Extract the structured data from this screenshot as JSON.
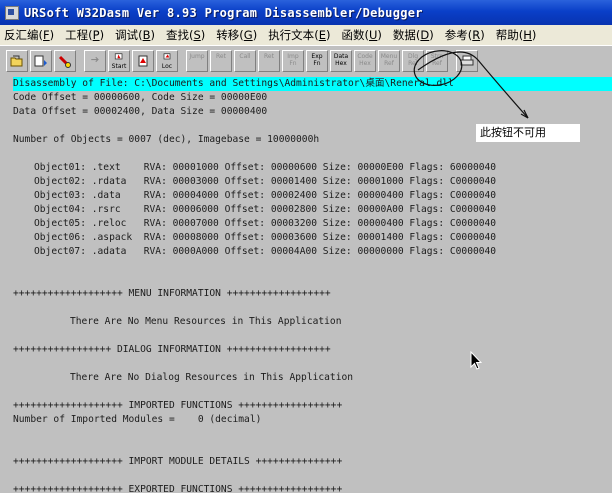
{
  "window": {
    "title": "URSoft W32Dasm Ver 8.93 Program Disassembler/Debugger"
  },
  "menu": [
    {
      "label": "反汇编",
      "accel": "F"
    },
    {
      "label": "工程",
      "accel": "P"
    },
    {
      "label": "调试",
      "accel": "B"
    },
    {
      "label": "查找",
      "accel": "S"
    },
    {
      "label": "转移",
      "accel": "G"
    },
    {
      "label": "执行文本",
      "accel": "E"
    },
    {
      "label": "函数",
      "accel": "U"
    },
    {
      "label": "数据",
      "accel": "D"
    },
    {
      "label": "参考",
      "accel": "R"
    },
    {
      "label": "帮助",
      "accel": "H"
    }
  ],
  "toolbar": {
    "buttons": [
      {
        "name": "open-disasm-button",
        "label": "",
        "icon": "open-file-icon",
        "enabled": true
      },
      {
        "name": "save-disasm-button",
        "label": "",
        "icon": "save-file-icon",
        "enabled": true
      },
      {
        "name": "find-button",
        "label": "",
        "icon": "flashlight-icon",
        "enabled": true
      },
      {
        "name": "goto-code-start-button",
        "label": "",
        "icon": "goto-icon",
        "enabled": false
      },
      {
        "name": "program-entry-button",
        "label": "Start",
        "icon": "entry-point-icon",
        "enabled": true
      },
      {
        "name": "goto-page-button",
        "label": "",
        "icon": "page-icon",
        "enabled": true
      },
      {
        "name": "goto-code-location-button",
        "label": "Loc",
        "icon": "location-icon",
        "enabled": true
      },
      {
        "name": "execute-jump-button",
        "label": "Jump",
        "icon": "jump-icon",
        "enabled": false
      },
      {
        "name": "return-from-jump-button",
        "label": "Ret",
        "icon": "return-icon",
        "enabled": false
      },
      {
        "name": "execute-call-button",
        "label": "Call",
        "icon": "call-icon",
        "enabled": false
      },
      {
        "name": "return-from-call-button",
        "label": "Ret",
        "icon": "return-icon",
        "enabled": false
      },
      {
        "name": "imports-button",
        "label": "Imp Fn",
        "icon": "imports-icon",
        "enabled": false
      },
      {
        "name": "exports-button",
        "label": "Exp Fn",
        "icon": "exports-icon",
        "enabled": true
      },
      {
        "name": "hex-data-button",
        "label": "Data Hex",
        "icon": "hex-data-icon",
        "enabled": true
      },
      {
        "name": "hex-code-button",
        "label": "Code Hex",
        "icon": "hex-code-icon",
        "enabled": false
      },
      {
        "name": "menu-ref-button",
        "label": "Menu Ref",
        "icon": "menu-ref-icon",
        "enabled": false
      },
      {
        "name": "dialog-ref-button",
        "label": "Dlg Ref",
        "icon": "dialog-ref-icon",
        "enabled": false
      },
      {
        "name": "string-ref-button",
        "label": "Strn Ref",
        "icon": "string-ref-icon",
        "enabled": false
      },
      {
        "name": "print-button",
        "label": "",
        "icon": "printer-icon",
        "enabled": true
      }
    ]
  },
  "listing": {
    "header": "Disassembly of File: C:\\Documents and Settings\\Administrator\\桌面\\Reneral.dll",
    "code_line": "Code Offset = 00000600, Code Size = 00000E00",
    "data_line": "Data Offset = 00002400, Data Size = 00000400",
    "objects_line": "Number of Objects = 0007 (dec), Imagebase = 10000000h",
    "objects": [
      "Object01: .text    RVA: 00001000 Offset: 00000600 Size: 00000E00 Flags: 60000040",
      "Object02: .rdata   RVA: 00003000 Offset: 00001400 Size: 00001000 Flags: C0000040",
      "Object03: .data    RVA: 00004000 Offset: 00002400 Size: 00000400 Flags: C0000040",
      "Object04: .rsrc    RVA: 00006000 Offset: 00002800 Size: 00000A00 Flags: C0000040",
      "Object05: .reloc   RVA: 00007000 Offset: 00003200 Size: 00000400 Flags: C0000040",
      "Object06: .aspack  RVA: 00008000 Offset: 00003600 Size: 00001400 Flags: C0000040",
      "Object07: .adata   RVA: 0000A000 Offset: 00004A00 Size: 00000000 Flags: C0000040"
    ],
    "menu_section": "+++++++++++++++++++ MENU INFORMATION ++++++++++++++++++",
    "menu_none": "There Are No Menu Resources in This Application",
    "dialog_section": "+++++++++++++++++ DIALOG INFORMATION ++++++++++++++++++",
    "dialog_none": "There Are No Dialog Resources in This Application",
    "imported_section": "+++++++++++++++++++ IMPORTED FUNCTIONS ++++++++++++++++++",
    "imported_count": "Number of Imported Modules =    0 (decimal)",
    "import_details_section": "+++++++++++++++++++ IMPORT MODULE DETAILS +++++++++++++++",
    "exported_section": "+++++++++++++++++++ EXPORTED FUNCTIONS ++++++++++++++++++"
  },
  "annotation": {
    "note": "此按钮不可用"
  }
}
